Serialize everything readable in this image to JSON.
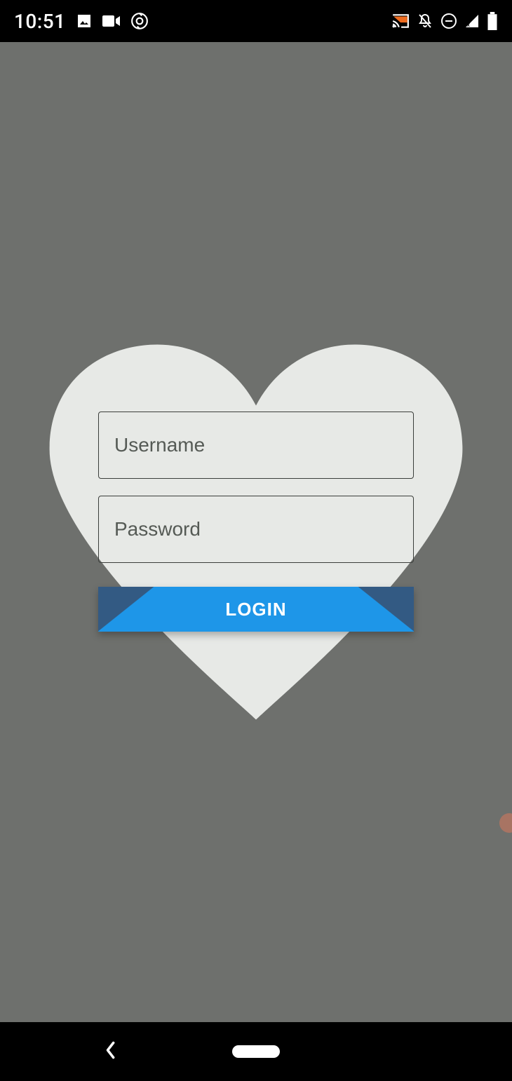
{
  "status_bar": {
    "time": "10:51"
  },
  "login": {
    "username_placeholder": "Username",
    "password_placeholder": "Password",
    "button_label": "LOGIN"
  },
  "colors": {
    "screen_bg": "#6e706d",
    "heart_bg": "#e7e9e6",
    "button_primary": "#1e96e8",
    "button_shade": "#335a83"
  }
}
